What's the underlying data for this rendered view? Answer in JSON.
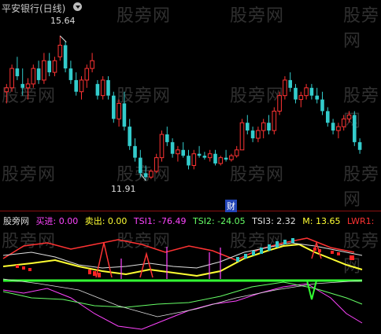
{
  "chart_title": "平安银行(日线)",
  "watermark": "股旁网",
  "price_labels": {
    "high": "15.64",
    "low": "11.91"
  },
  "event_badge": "财",
  "indicator": {
    "name": "股旁网",
    "items": [
      {
        "label": "买进: 0.00",
        "color": "#ff44ff"
      },
      {
        "label": "卖出: 0.00",
        "color": "#ffff33"
      },
      {
        "label": "TSI1: -76.49",
        "color": "#ff44ff"
      },
      {
        "label": "TSI2: -24.05",
        "color": "#66ff66"
      },
      {
        "label": "TSI3: 2.32",
        "color": "#e0e0e0"
      },
      {
        "label": "M: 13.65",
        "color": "#ffff33"
      },
      {
        "label": "LWR1:",
        "color": "#ff3333"
      }
    ]
  },
  "colors": {
    "up": "#ff3333",
    "down": "#33cccc",
    "zero_line": "#33ff33",
    "separator": "#8a1010"
  },
  "chart_data": {
    "type": "candlestick",
    "ylim": [
      11.5,
      16.2
    ],
    "candles": [
      [
        14.2,
        14.4,
        13.9,
        14.3
      ],
      [
        14.3,
        14.9,
        14.2,
        14.8
      ],
      [
        14.8,
        15.1,
        14.5,
        14.6
      ],
      [
        14.4,
        14.8,
        14.1,
        14.3
      ],
      [
        14.3,
        14.55,
        14.0,
        14.4
      ],
      [
        14.4,
        14.9,
        14.3,
        14.8
      ],
      [
        14.8,
        15.0,
        14.4,
        14.5
      ],
      [
        14.5,
        15.2,
        14.4,
        15.0
      ],
      [
        15.0,
        15.2,
        14.6,
        14.7
      ],
      [
        14.7,
        15.1,
        14.6,
        15.0
      ],
      [
        15.1,
        15.64,
        15.0,
        15.4
      ],
      [
        15.4,
        15.5,
        14.7,
        14.8
      ],
      [
        14.8,
        15.0,
        14.4,
        14.5
      ],
      [
        14.5,
        14.7,
        14.1,
        14.2
      ],
      [
        14.2,
        14.6,
        14.0,
        14.5
      ],
      [
        14.5,
        14.9,
        14.3,
        14.8
      ],
      [
        14.8,
        15.2,
        14.7,
        15.0
      ],
      [
        14.4,
        14.5,
        14.0,
        14.1
      ],
      [
        14.1,
        14.6,
        14.0,
        14.5
      ],
      [
        14.5,
        14.6,
        14.0,
        14.1
      ],
      [
        14.1,
        14.2,
        13.4,
        13.5
      ],
      [
        13.5,
        14.0,
        13.3,
        13.9
      ],
      [
        13.9,
        14.2,
        13.2,
        13.3
      ],
      [
        13.3,
        13.5,
        12.7,
        12.8
      ],
      [
        12.8,
        13.0,
        12.4,
        12.5
      ],
      [
        12.5,
        12.7,
        12.0,
        12.1
      ],
      [
        12.1,
        12.3,
        11.91,
        12.0
      ],
      [
        12.0,
        12.2,
        11.95,
        12.15
      ],
      [
        12.15,
        12.6,
        12.1,
        12.5
      ],
      [
        12.5,
        13.2,
        12.4,
        13.1
      ],
      [
        13.1,
        13.3,
        12.8,
        12.9
      ],
      [
        12.9,
        13.0,
        12.5,
        12.6
      ],
      [
        12.6,
        12.8,
        12.4,
        12.7
      ],
      [
        12.7,
        12.9,
        12.5,
        12.55
      ],
      [
        12.55,
        12.7,
        12.2,
        12.3
      ],
      [
        12.3,
        12.7,
        12.2,
        12.6
      ],
      [
        12.6,
        12.8,
        12.5,
        12.55
      ],
      [
        12.55,
        12.65,
        12.45,
        12.5
      ],
      [
        12.5,
        12.7,
        12.4,
        12.6
      ],
      [
        12.6,
        12.7,
        12.3,
        12.35
      ],
      [
        12.35,
        12.55,
        12.3,
        12.5
      ],
      [
        12.5,
        12.7,
        12.4,
        12.45
      ],
      [
        12.45,
        12.6,
        12.4,
        12.55
      ],
      [
        12.55,
        12.8,
        12.5,
        12.7
      ],
      [
        12.7,
        13.5,
        12.7,
        13.4
      ],
      [
        13.4,
        13.6,
        13.1,
        13.2
      ],
      [
        13.2,
        13.3,
        12.9,
        13.0
      ],
      [
        13.0,
        13.3,
        12.9,
        13.2
      ],
      [
        13.2,
        13.5,
        13.0,
        13.4
      ],
      [
        13.4,
        13.6,
        13.1,
        13.2
      ],
      [
        13.2,
        13.8,
        13.1,
        13.7
      ],
      [
        13.7,
        14.2,
        13.6,
        14.1
      ],
      [
        14.1,
        14.6,
        14.0,
        14.5
      ],
      [
        14.5,
        14.7,
        14.2,
        14.3
      ],
      [
        14.3,
        14.4,
        13.9,
        14.0
      ],
      [
        14.0,
        14.2,
        13.8,
        14.1
      ],
      [
        14.1,
        14.4,
        14.0,
        14.3
      ],
      [
        14.3,
        14.4,
        14.0,
        14.1
      ],
      [
        14.1,
        14.3,
        13.9,
        14.0
      ],
      [
        14.0,
        14.2,
        13.6,
        13.7
      ],
      [
        13.7,
        13.8,
        13.3,
        13.4
      ],
      [
        13.4,
        13.5,
        13.1,
        13.2
      ],
      [
        13.2,
        13.4,
        13.0,
        13.3
      ],
      [
        13.3,
        13.6,
        13.2,
        13.5
      ],
      [
        13.5,
        13.7,
        13.4,
        13.6
      ],
      [
        13.6,
        13.7,
        12.8,
        12.9
      ],
      [
        12.9,
        13.0,
        12.6,
        12.7
      ]
    ]
  }
}
